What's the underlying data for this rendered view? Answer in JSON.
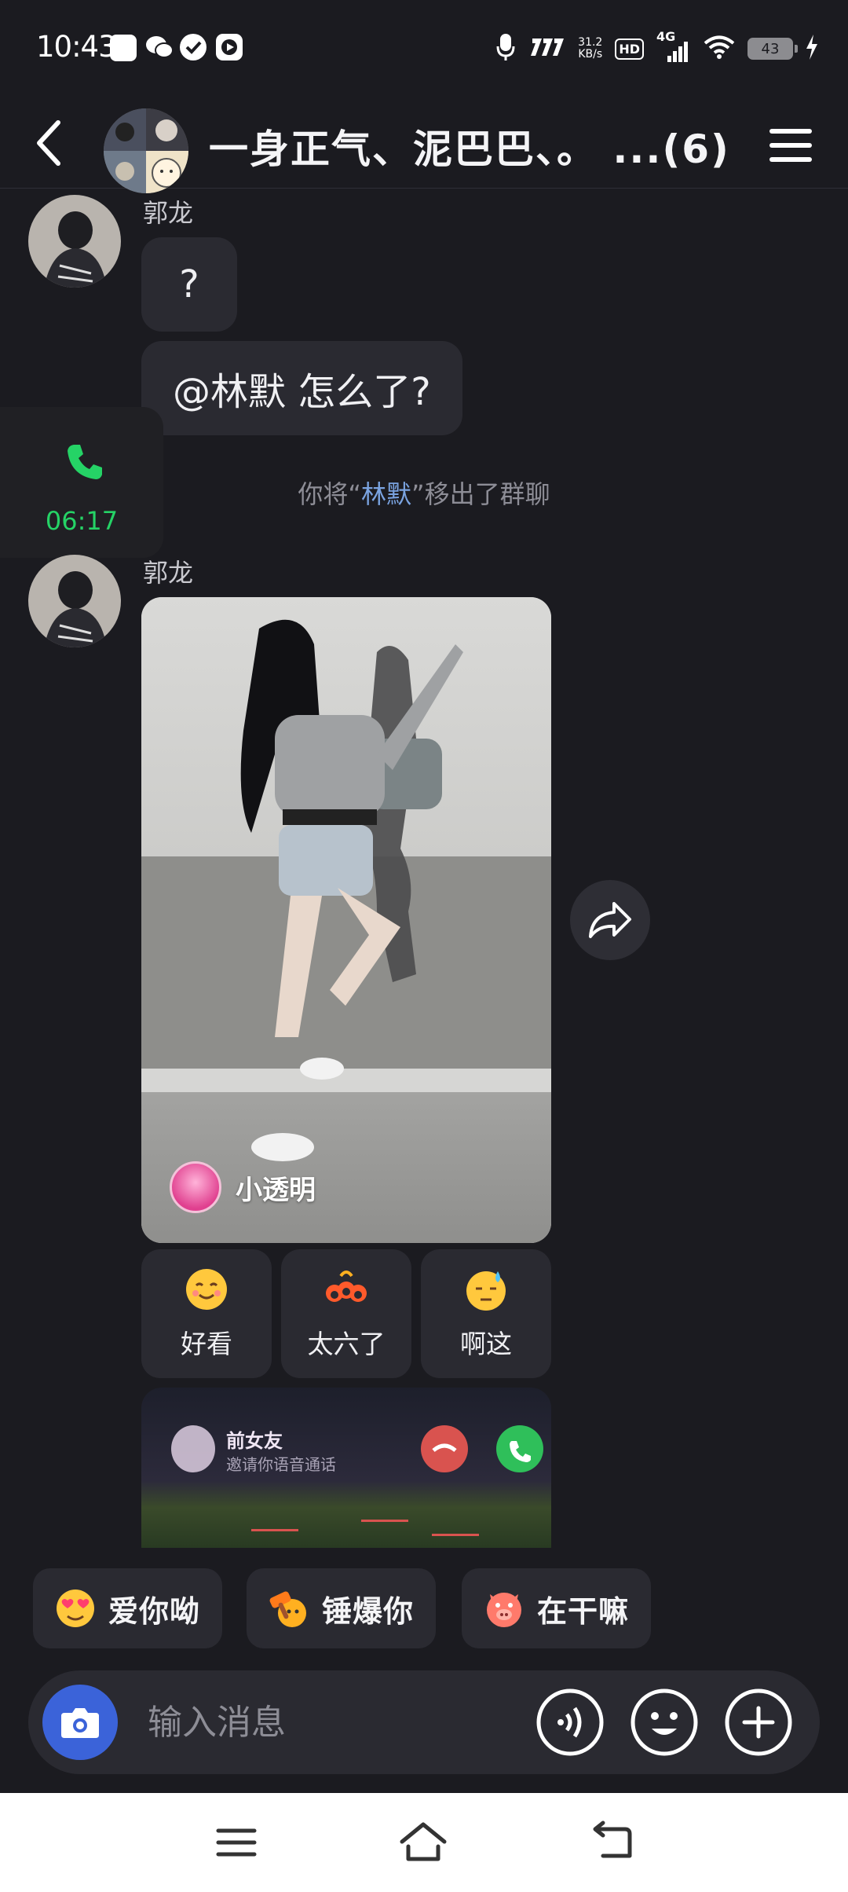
{
  "status_bar": {
    "time": "10:43",
    "net_speed_value": "31.2",
    "net_speed_unit": "KB/s",
    "hd_badge": "HD",
    "network": "4G",
    "battery": "43"
  },
  "header": {
    "title": "一身正气、泥巴巴、。 ...(6)"
  },
  "messages": {
    "sender_1": "郭龙",
    "bubble_1": "?",
    "bubble_2": "@林默 怎么了?",
    "system_prefix": "你将“",
    "system_name": "林默",
    "system_suffix": "”移出了群聊",
    "sender_2": "郭龙",
    "video_author": "小透明",
    "reactions": [
      {
        "label": "好看",
        "icon": "smiling-face-emoji"
      },
      {
        "label": "太六了",
        "icon": "666-emoji"
      },
      {
        "label": "啊这",
        "icon": "sweat-face-emoji"
      }
    ],
    "call_card": {
      "caller": "前女友",
      "subtitle": "邀请你语音通话"
    }
  },
  "call_float": {
    "duration": "06:17"
  },
  "quick_replies": [
    {
      "label": "爱你呦",
      "icon": "heart-eyes-emoji"
    },
    {
      "label": "锤爆你",
      "icon": "hammer-emoji"
    },
    {
      "label": "在干嘛",
      "icon": "pig-emoji"
    }
  ],
  "input": {
    "placeholder": "输入消息"
  },
  "colors": {
    "background": "#1b1b20",
    "bubble": "#2a2a31",
    "accent_blue": "#3b63d9",
    "call_green": "#25d366",
    "mention_blue": "#7aa3e0"
  }
}
